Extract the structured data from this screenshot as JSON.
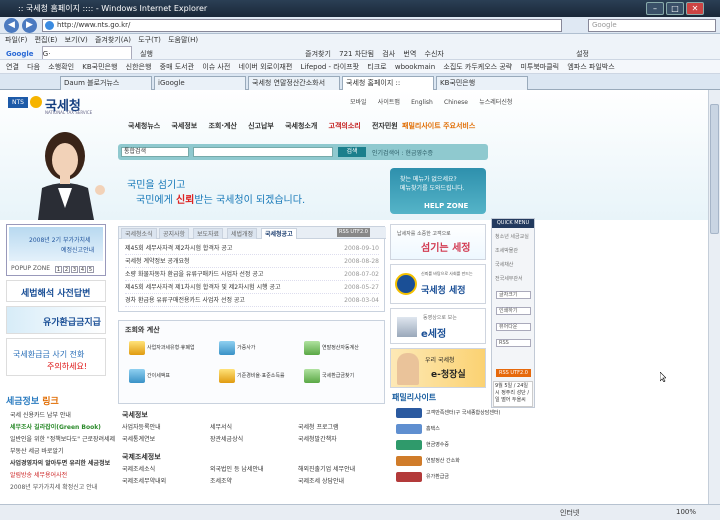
{
  "window": {
    "title": ":: 국세청 홈페이지 :::: - Windows Internet Explorer"
  },
  "browser": {
    "url": "http://www.nts.go.kr/",
    "search_placeholder": "Google",
    "menu": [
      "파일(F)",
      "편집(E)",
      "보기(V)",
      "즐겨찾기(A)",
      "도구(T)",
      "도움말(H)"
    ],
    "toolbar1": [
      "Google",
      "G·",
      "실행",
      "즐겨찾기",
      "721 차단됨",
      "검사",
      "번역",
      "수신자",
      "설정"
    ],
    "toolbar2": [
      "연결",
      "다음",
      "소행확인",
      "KB국민은행",
      "신한은행",
      "중매 도서관",
      "이슈 사전",
      "네이버 외로이재편",
      "Lifepod - 라이프팟",
      "티크로",
      "wbookmain",
      "소집도 카두케오스 공략",
      "미투북마클릭",
      "엠파스 파일박스"
    ],
    "tabs": [
      "Daum 블로거뉴스",
      "iGoogle",
      "국세청 연말정산간소화서",
      "국세청 홈페이지 ::",
      "KB국민은행"
    ],
    "status_left": "",
    "status_zone": "인터넷",
    "zoom": "100%"
  },
  "site": {
    "logo_badge": "NTS",
    "logo": "국세청",
    "logo_sub": "NATIONAL TAX SERVICE",
    "util": [
      "모바일",
      "사이트맵",
      "English",
      "Chinese",
      "뉴스레터신청"
    ],
    "gnav": [
      "국세청뉴스",
      "국세정보",
      "조회·계산",
      "신고납부",
      "국세청소개",
      "고객의소리",
      "전자민원"
    ],
    "family_site_label": "패밀리사이트 주요서비스",
    "search": {
      "select": "통합검색",
      "button": "검색",
      "popular": "인기검색어 : 현금영수증"
    },
    "slogan1": "국민을 섬기고",
    "slogan2_a": "국민에게 ",
    "slogan2_b": "신뢰",
    "slogan2_c": "받는 국세청이 되겠습니다.",
    "helpzone": {
      "a": "찾는 메뉴가 없으세요?",
      "b": "메뉴찾기를 도와드립니다.",
      "c": "HELP ZONE"
    }
  },
  "left": {
    "popup_text1": "2008년 2기 부가가치세",
    "popup_text2": "예정신고안내",
    "popup_label": "POPUP ZONE",
    "popup_nums": [
      "1",
      "2",
      "3",
      "4",
      "5"
    ],
    "banner_tax": "세법해석 사전답변",
    "banner_oil": "유가환급금지급",
    "banner_bounce_a": "국세환급금 사기 전화",
    "banner_bounce_b": "주의하세요!",
    "taxinfo_a": "세금정보 ",
    "taxinfo_b": "링크",
    "taxinfo_items": [
      "국세 신용카드 납부 안내",
      "세무조사 길라잡이(Green Book)",
      "일반인을 위한 \"정책보다도\" 근로장려세제",
      "부동산 세금 바로알기",
      "사업경영자의 알아두면 유리한 세금정보",
      "알림방송 세무용어사전",
      "2008년 부가가치세 확정신고 안내"
    ]
  },
  "notice": {
    "tabs": [
      "국세청소식",
      "공지사항",
      "보도자료",
      "세법개정",
      "국세청공고"
    ],
    "rss": "RSS UTF2.0",
    "rows": [
      {
        "title": "제45회 세무사자격 제2차시험 합격자 공고",
        "date": "2008-09-10"
      },
      {
        "title": "국세청 계약정보 공개요청",
        "date": "2008-08-28"
      },
      {
        "title": "소량 화물자동차 환급을 유류구매카드 사업자 선정 공고",
        "date": "2008-07-02"
      },
      {
        "title": "제45회 세무사자격 제1차시험 합격자 및 제2차시험 시행 공고",
        "date": "2008-05-27"
      },
      {
        "title": "경차 환급용 유류구매전용카드 사업자 선정 공고",
        "date": "2008-03-04"
      }
    ]
  },
  "calc": {
    "title": "조회와 계산",
    "items": [
      "사업자과세유형·휴폐업",
      "가증사가",
      "연말정산자동계산",
      "간이세액표",
      "기준경비율·표준소득률",
      "국세환급금찾기"
    ]
  },
  "info": {
    "title1": "국세정보",
    "row1": [
      "사업자등록안내",
      "세무서식",
      "국세청 프로그램"
    ],
    "row2": [
      "국세통계연보",
      "장관세금상식",
      "국세청발간책자"
    ],
    "title2": "국제조세정보",
    "row3": [
      "국제조세소식",
      "외국법인 등 납세안내",
      "해외진출기업 세무안내"
    ],
    "row4": [
      "국제조세무약내외",
      "조세조약",
      "국제조세 상담안내"
    ]
  },
  "right": {
    "rb1_a": "납세자를 소중한 고객으로",
    "rb1_b": "섬기는 세정",
    "rb2_a": "신뢰를 바탕으로 사회를 만드는",
    "rb2_b": "국세청 세정",
    "rb3_a": "동영상으로 보는",
    "rb3_b": "e세정",
    "rb4_a": "우리 국세청",
    "rb4_b": "e-청장실",
    "family_title": "패밀리사이트",
    "family": [
      "고객만족센터(구 국세종합상담센터)",
      "홈택스",
      "현금영수증",
      "연말정산 간소화",
      "유가환급금"
    ]
  },
  "quick": {
    "header": "QUICK MENU",
    "items": [
      "청소년 세금교실",
      "조세박물관",
      "국세채산",
      "전국세무관서"
    ],
    "btns": [
      "글자크기",
      "인쇄하기",
      "뷰어다운",
      "RSS"
    ],
    "rss": "RSS UTF2.0",
    "date": "9월 5일 / 24일 시 정주리 성단 / 일 떨어 두을씨"
  }
}
